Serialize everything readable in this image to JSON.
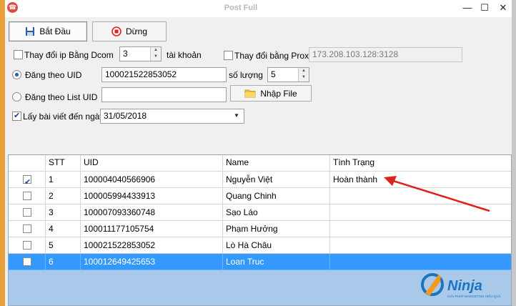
{
  "window": {
    "title": "Post Full",
    "minimize": "—",
    "maximize": "☐",
    "close": "✕"
  },
  "toolbar": {
    "start_label": "Bắt Đầu",
    "stop_label": "Dừng"
  },
  "options": {
    "change_ip_label": "Thay đổi ip Bằng Dcom",
    "accounts_value": "3",
    "accounts_suffix": "tài khoản",
    "change_proxy_label": "Thay đổi bằng Proxy",
    "proxy_value": "173.208.103.128:3128",
    "post_by_uid_label": "Đăng theo UID",
    "uid_value": "100021522853052",
    "quantity_label": "số lượng",
    "quantity_value": "5",
    "post_by_list_label": "Đăng theo List UID",
    "list_uid_value": "",
    "import_file_label": "Nhập File",
    "fetch_posts_label": "Lấy bài viết đến ngày",
    "date_value": "31/05/2018"
  },
  "table": {
    "columns": [
      "",
      "STT",
      "UID",
      "Name",
      "Tình Trạng"
    ],
    "rows": [
      {
        "checked": true,
        "stt": "1",
        "uid": "100004040566906",
        "name": "Nguyễn Việt",
        "status": "Hoàn thành"
      },
      {
        "checked": false,
        "stt": "2",
        "uid": "100005994433913",
        "name": "Quang Chinh",
        "status": ""
      },
      {
        "checked": false,
        "stt": "3",
        "uid": "100007093360748",
        "name": "Sạo Láo",
        "status": ""
      },
      {
        "checked": false,
        "stt": "4",
        "uid": "100011177105754",
        "name": "Phạm Hưởng",
        "status": ""
      },
      {
        "checked": false,
        "stt": "5",
        "uid": "100021522853052",
        "name": "Lò Hà Châu",
        "status": ""
      },
      {
        "checked": false,
        "stt": "6",
        "uid": "100012649425653",
        "name": "Loan Truc",
        "status": ""
      }
    ],
    "selected_row": 5
  },
  "logo": {
    "text": "Ninja",
    "tagline": "GIẢI PHÁP MARKETING HIỆU QUẢ"
  },
  "colors": {
    "selection": "#3399ff",
    "grid_background": "#a9c9ea",
    "annotation_arrow": "#e0201c",
    "logo_blue": "#1e73be",
    "logo_orange": "#f39a1e"
  }
}
